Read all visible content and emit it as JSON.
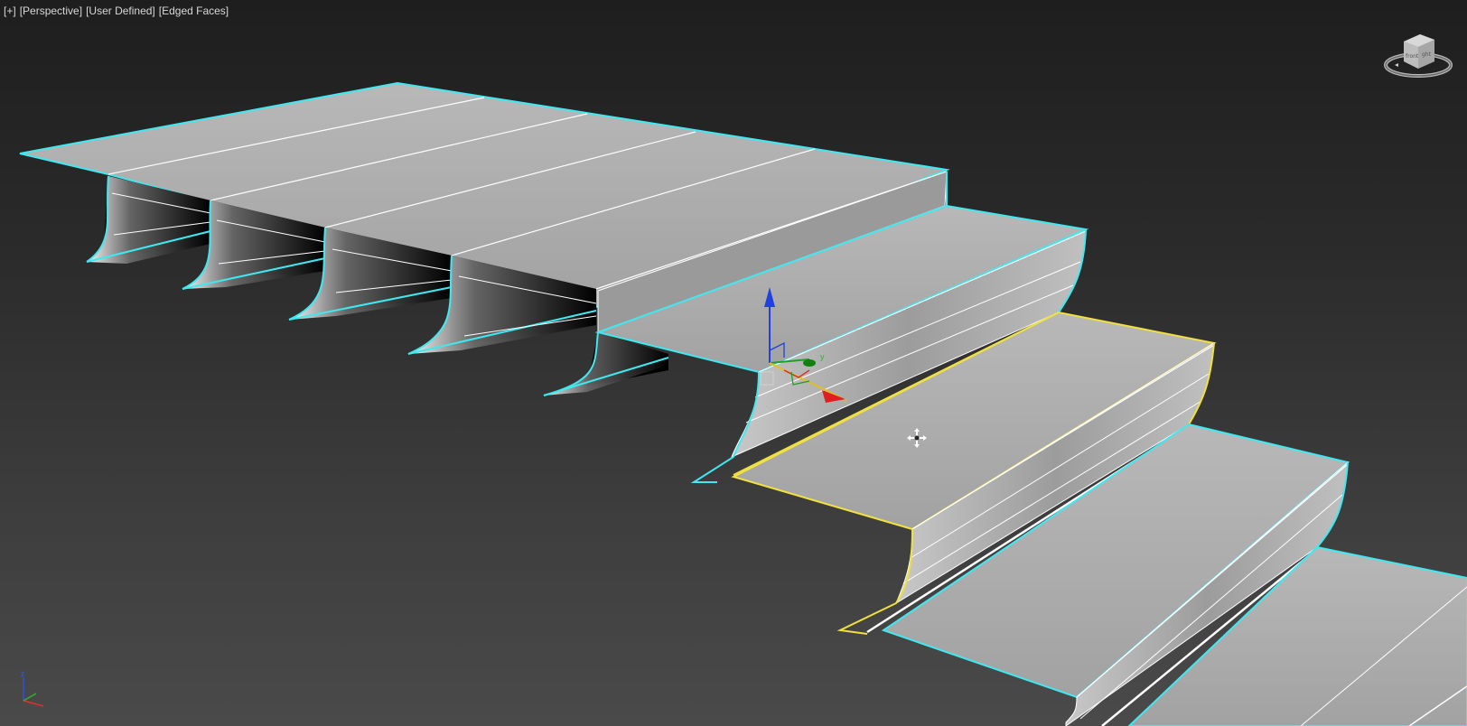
{
  "viewport": {
    "labels": {
      "plus": "[+]",
      "view": "[Perspective]",
      "shading_style": "[User Defined]",
      "edged_faces": "[Edged Faces]"
    },
    "background_top": "#1e1e1e",
    "background_bottom": "#4a4a4a"
  },
  "viewcube": {
    "icon": "viewcube-icon",
    "faces": {
      "front": "front",
      "top_right": "ght"
    }
  },
  "gizmo": {
    "icon": "move-gizmo-icon",
    "axes": {
      "x": "x",
      "y": "y",
      "z": "z"
    },
    "colors": {
      "x": "#e02020",
      "y": "#20a020",
      "z": "#2040e0"
    }
  },
  "world_axis": {
    "icon": "world-axis-tripod-icon",
    "axes": {
      "z": "z"
    }
  },
  "cursor": {
    "icon": "move-cursor-icon"
  },
  "scene": {
    "object_description": "staircase-mesh",
    "selection_color": "#40e8f0",
    "highlight_color": "#f0e040",
    "surface_color": "#a8a8a8"
  }
}
